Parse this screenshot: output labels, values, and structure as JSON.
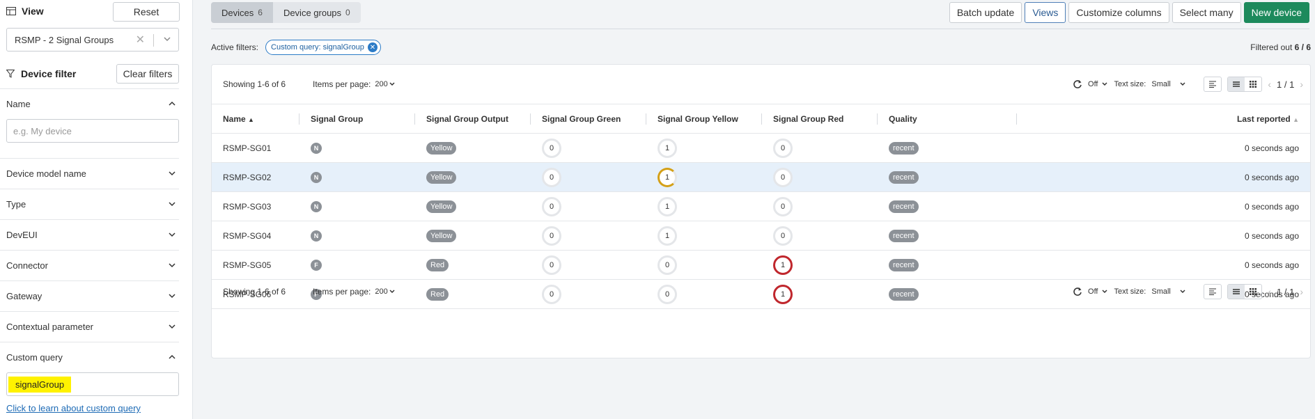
{
  "sidebar": {
    "view_title": "View",
    "reset_label": "Reset",
    "view_value": "RSMP - 2 Signal Groups",
    "filter_title": "Device filter",
    "clear_filters_label": "Clear filters",
    "name_label": "Name",
    "name_placeholder": "e.g. My device",
    "sections": [
      "Device model name",
      "Type",
      "DevEUI",
      "Connector",
      "Gateway",
      "Contextual parameter"
    ],
    "custom_query_label": "Custom query",
    "custom_query_value": "signalGroup",
    "learn_link": "Click to learn about custom query"
  },
  "tabs": {
    "devices_label": "Devices",
    "devices_count": "6",
    "groups_label": "Device groups",
    "groups_count": "0"
  },
  "toolbar": {
    "batch_update": "Batch update",
    "views": "Views",
    "customize_columns": "Customize columns",
    "select_many": "Select many",
    "new_device": "New device"
  },
  "filters": {
    "active_label": "Active filters:",
    "chip": "Custom query: signalGroup",
    "filtered_out_label": "Filtered out",
    "filtered_out_value": "6 / 6"
  },
  "pager": {
    "showing": "Showing 1-6 of 6",
    "items_per_page_label": "Items per page:",
    "items_per_page": "200",
    "refresh": "Off",
    "text_size_label": "Text size:",
    "text_size": "Small",
    "page": "1 / 1"
  },
  "columns": [
    "Name",
    "Signal Group",
    "Signal Group Output",
    "Signal Group Green",
    "Signal Group Yellow",
    "Signal Group Red",
    "Quality",
    "Last reported"
  ],
  "rows": [
    {
      "name": "RSMP-SG01",
      "group": "N",
      "output": "Yellow",
      "green": "0",
      "yellow": "1",
      "red": "0",
      "quality": "recent",
      "last": "0 seconds ago"
    },
    {
      "name": "RSMP-SG02",
      "group": "N",
      "output": "Yellow",
      "green": "0",
      "yellow": "1",
      "red": "0",
      "quality": "recent",
      "last": "0 seconds ago"
    },
    {
      "name": "RSMP-SG03",
      "group": "N",
      "output": "Yellow",
      "green": "0",
      "yellow": "1",
      "red": "0",
      "quality": "recent",
      "last": "0 seconds ago"
    },
    {
      "name": "RSMP-SG04",
      "group": "N",
      "output": "Yellow",
      "green": "0",
      "yellow": "1",
      "red": "0",
      "quality": "recent",
      "last": "0 seconds ago"
    },
    {
      "name": "RSMP-SG05",
      "group": "F",
      "output": "Red",
      "green": "0",
      "yellow": "0",
      "red": "1",
      "quality": "recent",
      "last": "0 seconds ago"
    },
    {
      "name": "RSMP-SG06",
      "group": "F",
      "output": "Red",
      "green": "0",
      "yellow": "0",
      "red": "1",
      "quality": "recent",
      "last": "0 seconds ago"
    }
  ],
  "colors": {
    "primary": "#1d8a5c",
    "accent": "#2b7bc7",
    "red": "#c0272d",
    "yellow": "#d4a017",
    "highlight": "#fff200"
  }
}
